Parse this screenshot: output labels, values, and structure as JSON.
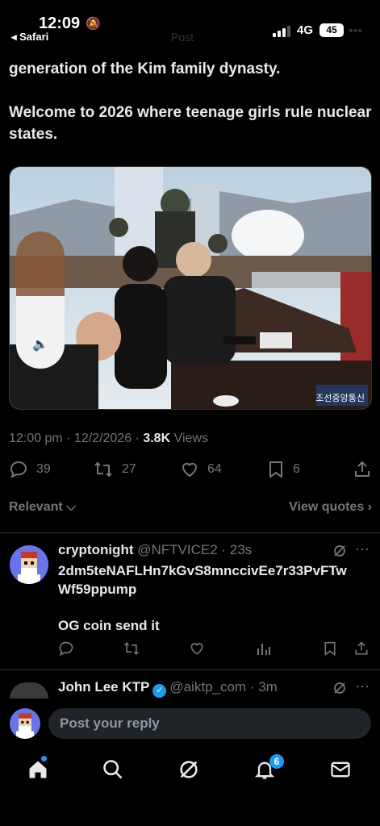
{
  "status_bar": {
    "time": "12:09",
    "back_app": "◂ Safari",
    "header_ghost": "Post",
    "network": "4G",
    "battery": "45",
    "more": "•••"
  },
  "tweet": {
    "text_lines": [
      "generation of the Kim family dynasty.",
      "Welcome to 2026 where teenage girls rule nuclear states."
    ],
    "watermark": "조선중앙통신",
    "timestamp": "12:00 pm · 12/2/2026 · ",
    "views_count": "3.8K",
    "views_label": " Views",
    "replies": "39",
    "reposts": "27",
    "likes": "64",
    "bookmarks": "6"
  },
  "filters": {
    "relevant": "Relevant ⌵",
    "view_quotes": "View quotes ›"
  },
  "replies": [
    {
      "name": "cryptonight",
      "handle": " @NFTVICE2 · 23s",
      "body_line1": "2dm5teNAFLHn7kGvS8mnccivEe7r33PvFTw",
      "body_line1b": "Wf59ppump",
      "body_line2": "OG coin send it",
      "more": "···"
    },
    {
      "name": "John Lee KTP",
      "handle": "@aiktp_com · 3m",
      "more": "···"
    }
  ],
  "reply_bar": {
    "placeholder": "Post your reply"
  },
  "tabbar": {
    "notif_count": "6"
  },
  "colors": {
    "accent": "#1d9bf0",
    "background": "#000000",
    "muted": "#71767b",
    "text": "#e7e9ea"
  }
}
